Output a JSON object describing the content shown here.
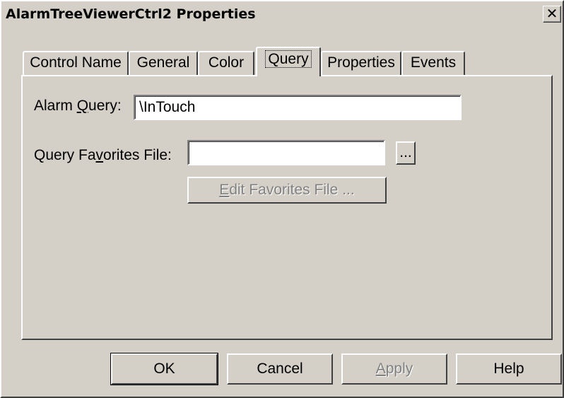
{
  "window": {
    "title": "AlarmTreeViewerCtrl2 Properties",
    "close_glyph": "✕",
    "close_icon": "close-icon"
  },
  "tabs": [
    {
      "label": "Control Name",
      "active": false
    },
    {
      "label": "General",
      "active": false
    },
    {
      "label": "Color",
      "active": false
    },
    {
      "label": "Query",
      "active": true
    },
    {
      "label": "Properties",
      "active": false
    },
    {
      "label": "Events",
      "active": false
    }
  ],
  "query_tab": {
    "alarm_query": {
      "label_prefix": "Alarm ",
      "label_accel": "Q",
      "label_suffix": "uery:",
      "value": "\\InTouch"
    },
    "favorites_file": {
      "label_prefix": "Query Fa",
      "label_accel": "v",
      "label_suffix": "orites File:",
      "value": "",
      "browse_label": "..."
    },
    "edit_favorites": {
      "accel": "E",
      "label_suffix": "dit Favorites File ...",
      "enabled": false
    }
  },
  "buttons": {
    "ok": "OK",
    "cancel": "Cancel",
    "apply_accel": "A",
    "apply_suffix": "pply",
    "apply_enabled": false,
    "help": "Help"
  }
}
